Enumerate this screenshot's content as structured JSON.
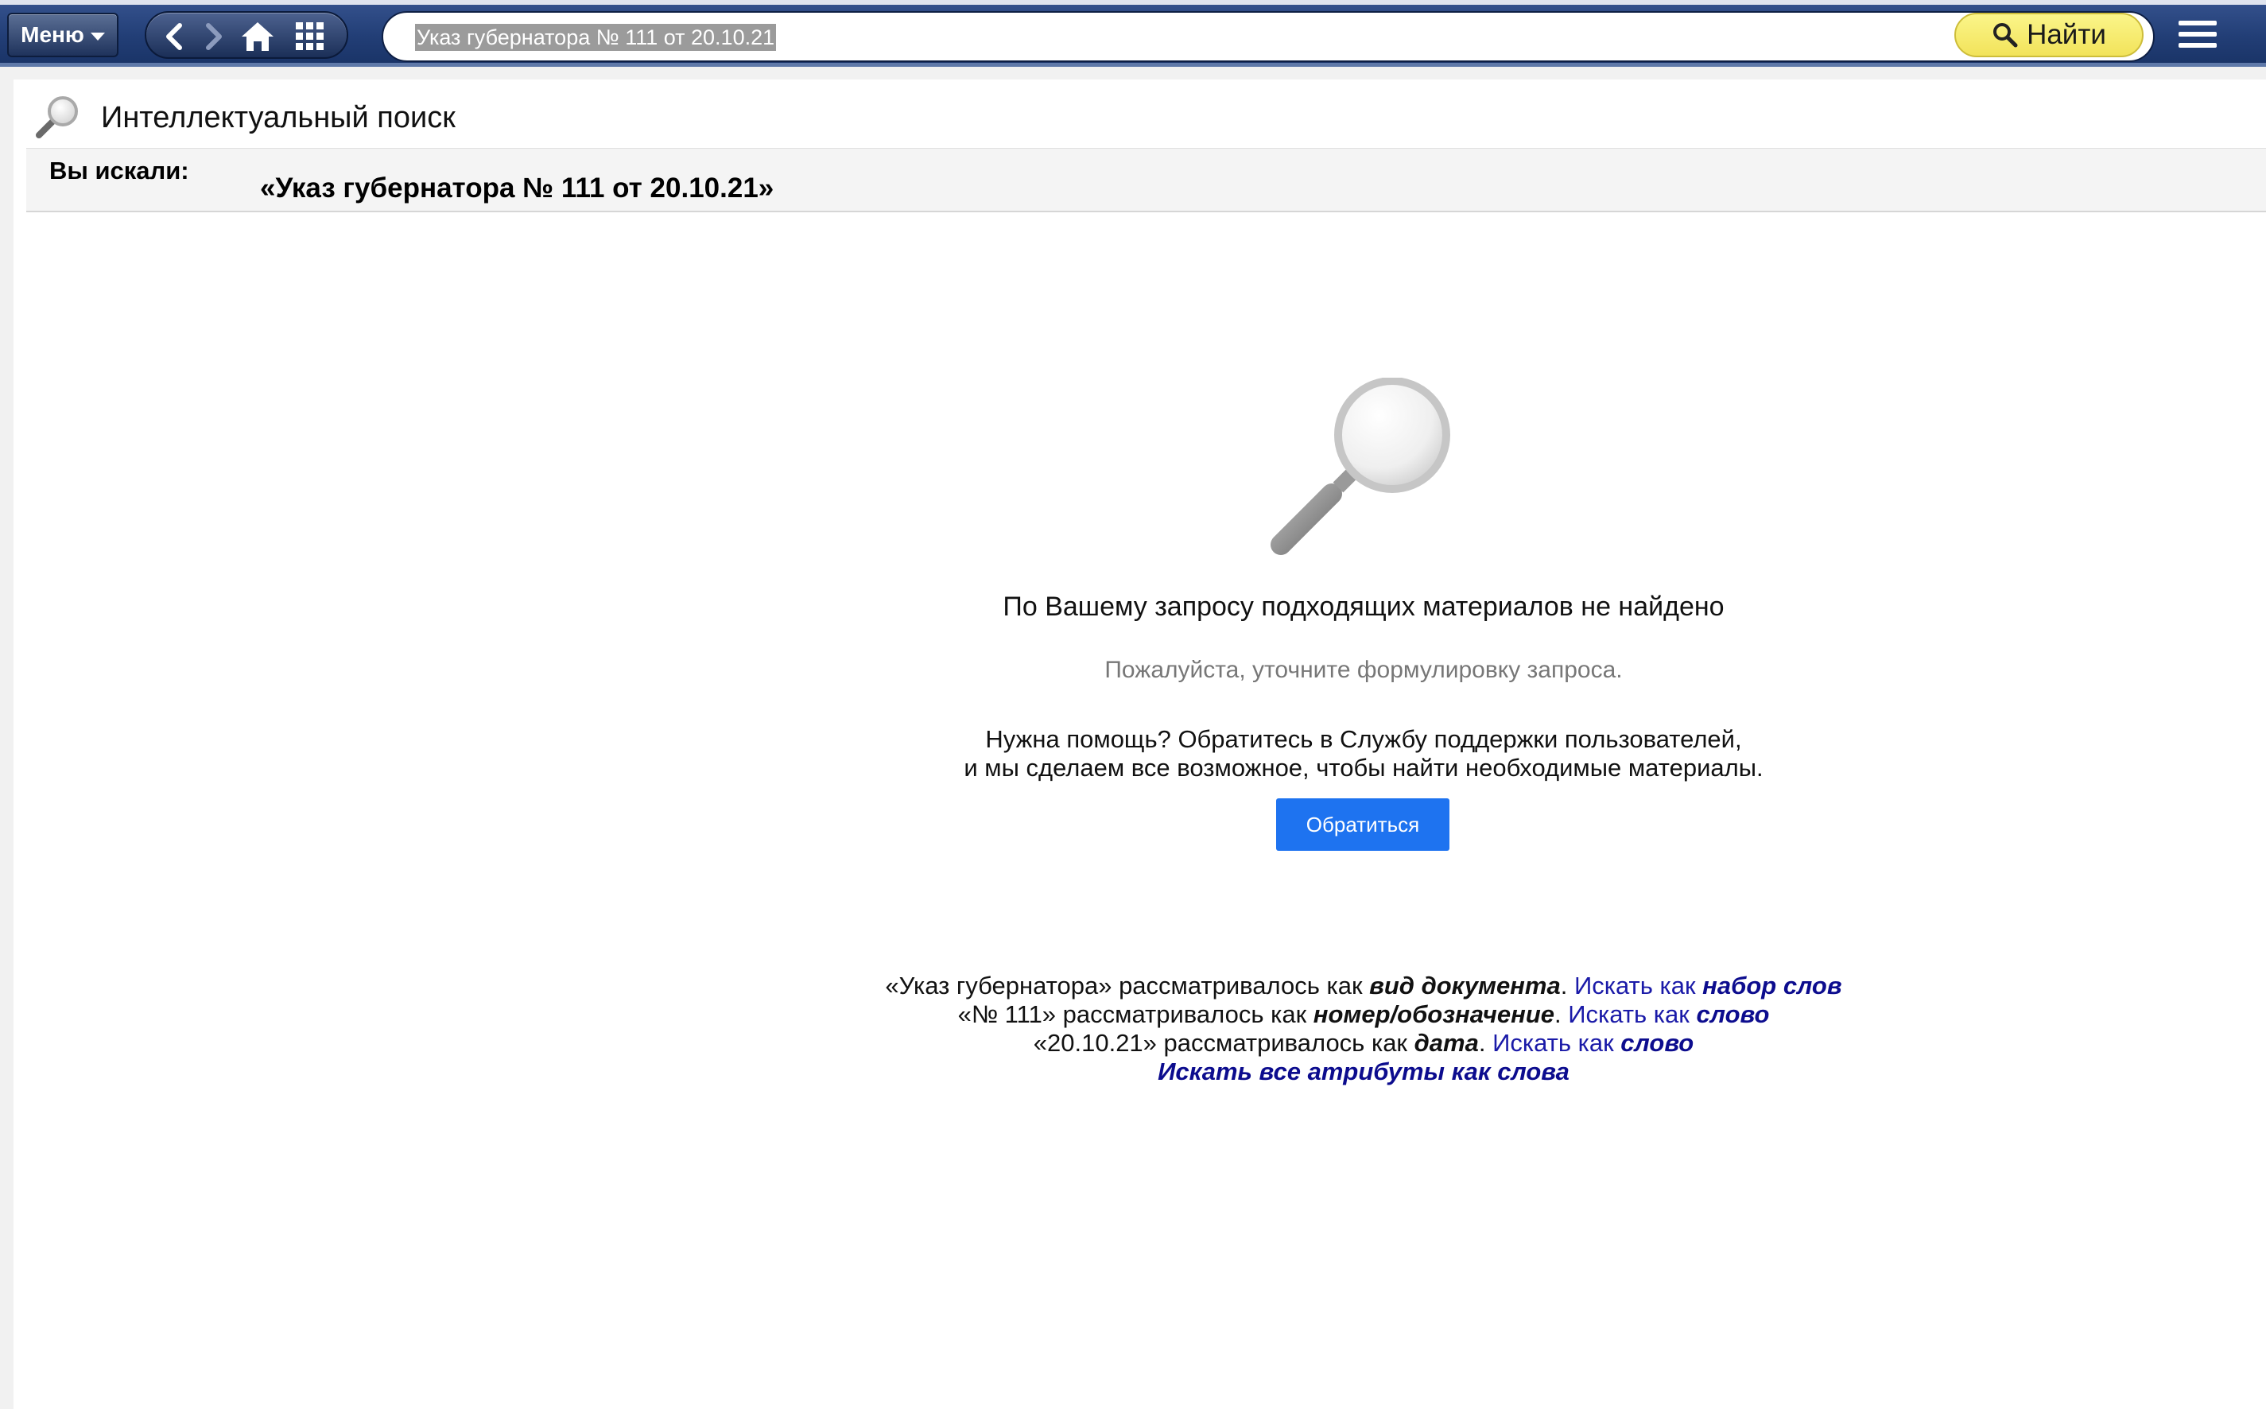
{
  "toolbar": {
    "menu_label": "Меню",
    "search_value": "Указ губернатора № 111 от 20.10.21",
    "find_label": "Найти"
  },
  "page": {
    "title": "Интеллектуальный поиск",
    "query_label": "Вы искали:",
    "query_value": "«Указ губернатора № 111 от 20.10.21»"
  },
  "empty_state": {
    "main": "По Вашему запросу подходящих материалов не найдено",
    "sub": "Пожалуйста, уточните формулировку запроса.",
    "help_line1": "Нужна помощь? Обратитесь в Службу поддержки пользователей,",
    "help_line2": "и мы сделаем все возможное, чтобы найти необходимые материалы.",
    "contact_label": "Обратиться"
  },
  "interpretations": [
    {
      "term": "«Указ губернатора»",
      "mid": " рассматривалось как ",
      "as": "вид документа",
      "link_prefix": "Искать как ",
      "link_target": "набор слов"
    },
    {
      "term": "«№ 111»",
      "mid": " рассматривалось как ",
      "as": "номер/обозначение",
      "link_prefix": "Искать как ",
      "link_target": "слово"
    },
    {
      "term": "«20.10.21»",
      "mid": " рассматривалось как ",
      "as": "дата",
      "link_prefix": "Искать как ",
      "link_target": "слово"
    }
  ],
  "search_all_label": "Искать все атрибуты как слова",
  "icons": [
    "chevron-left-icon",
    "chevron-right-icon",
    "home-icon",
    "grid-icon",
    "search-icon",
    "hamburger-icon",
    "magnifier-icon"
  ]
}
